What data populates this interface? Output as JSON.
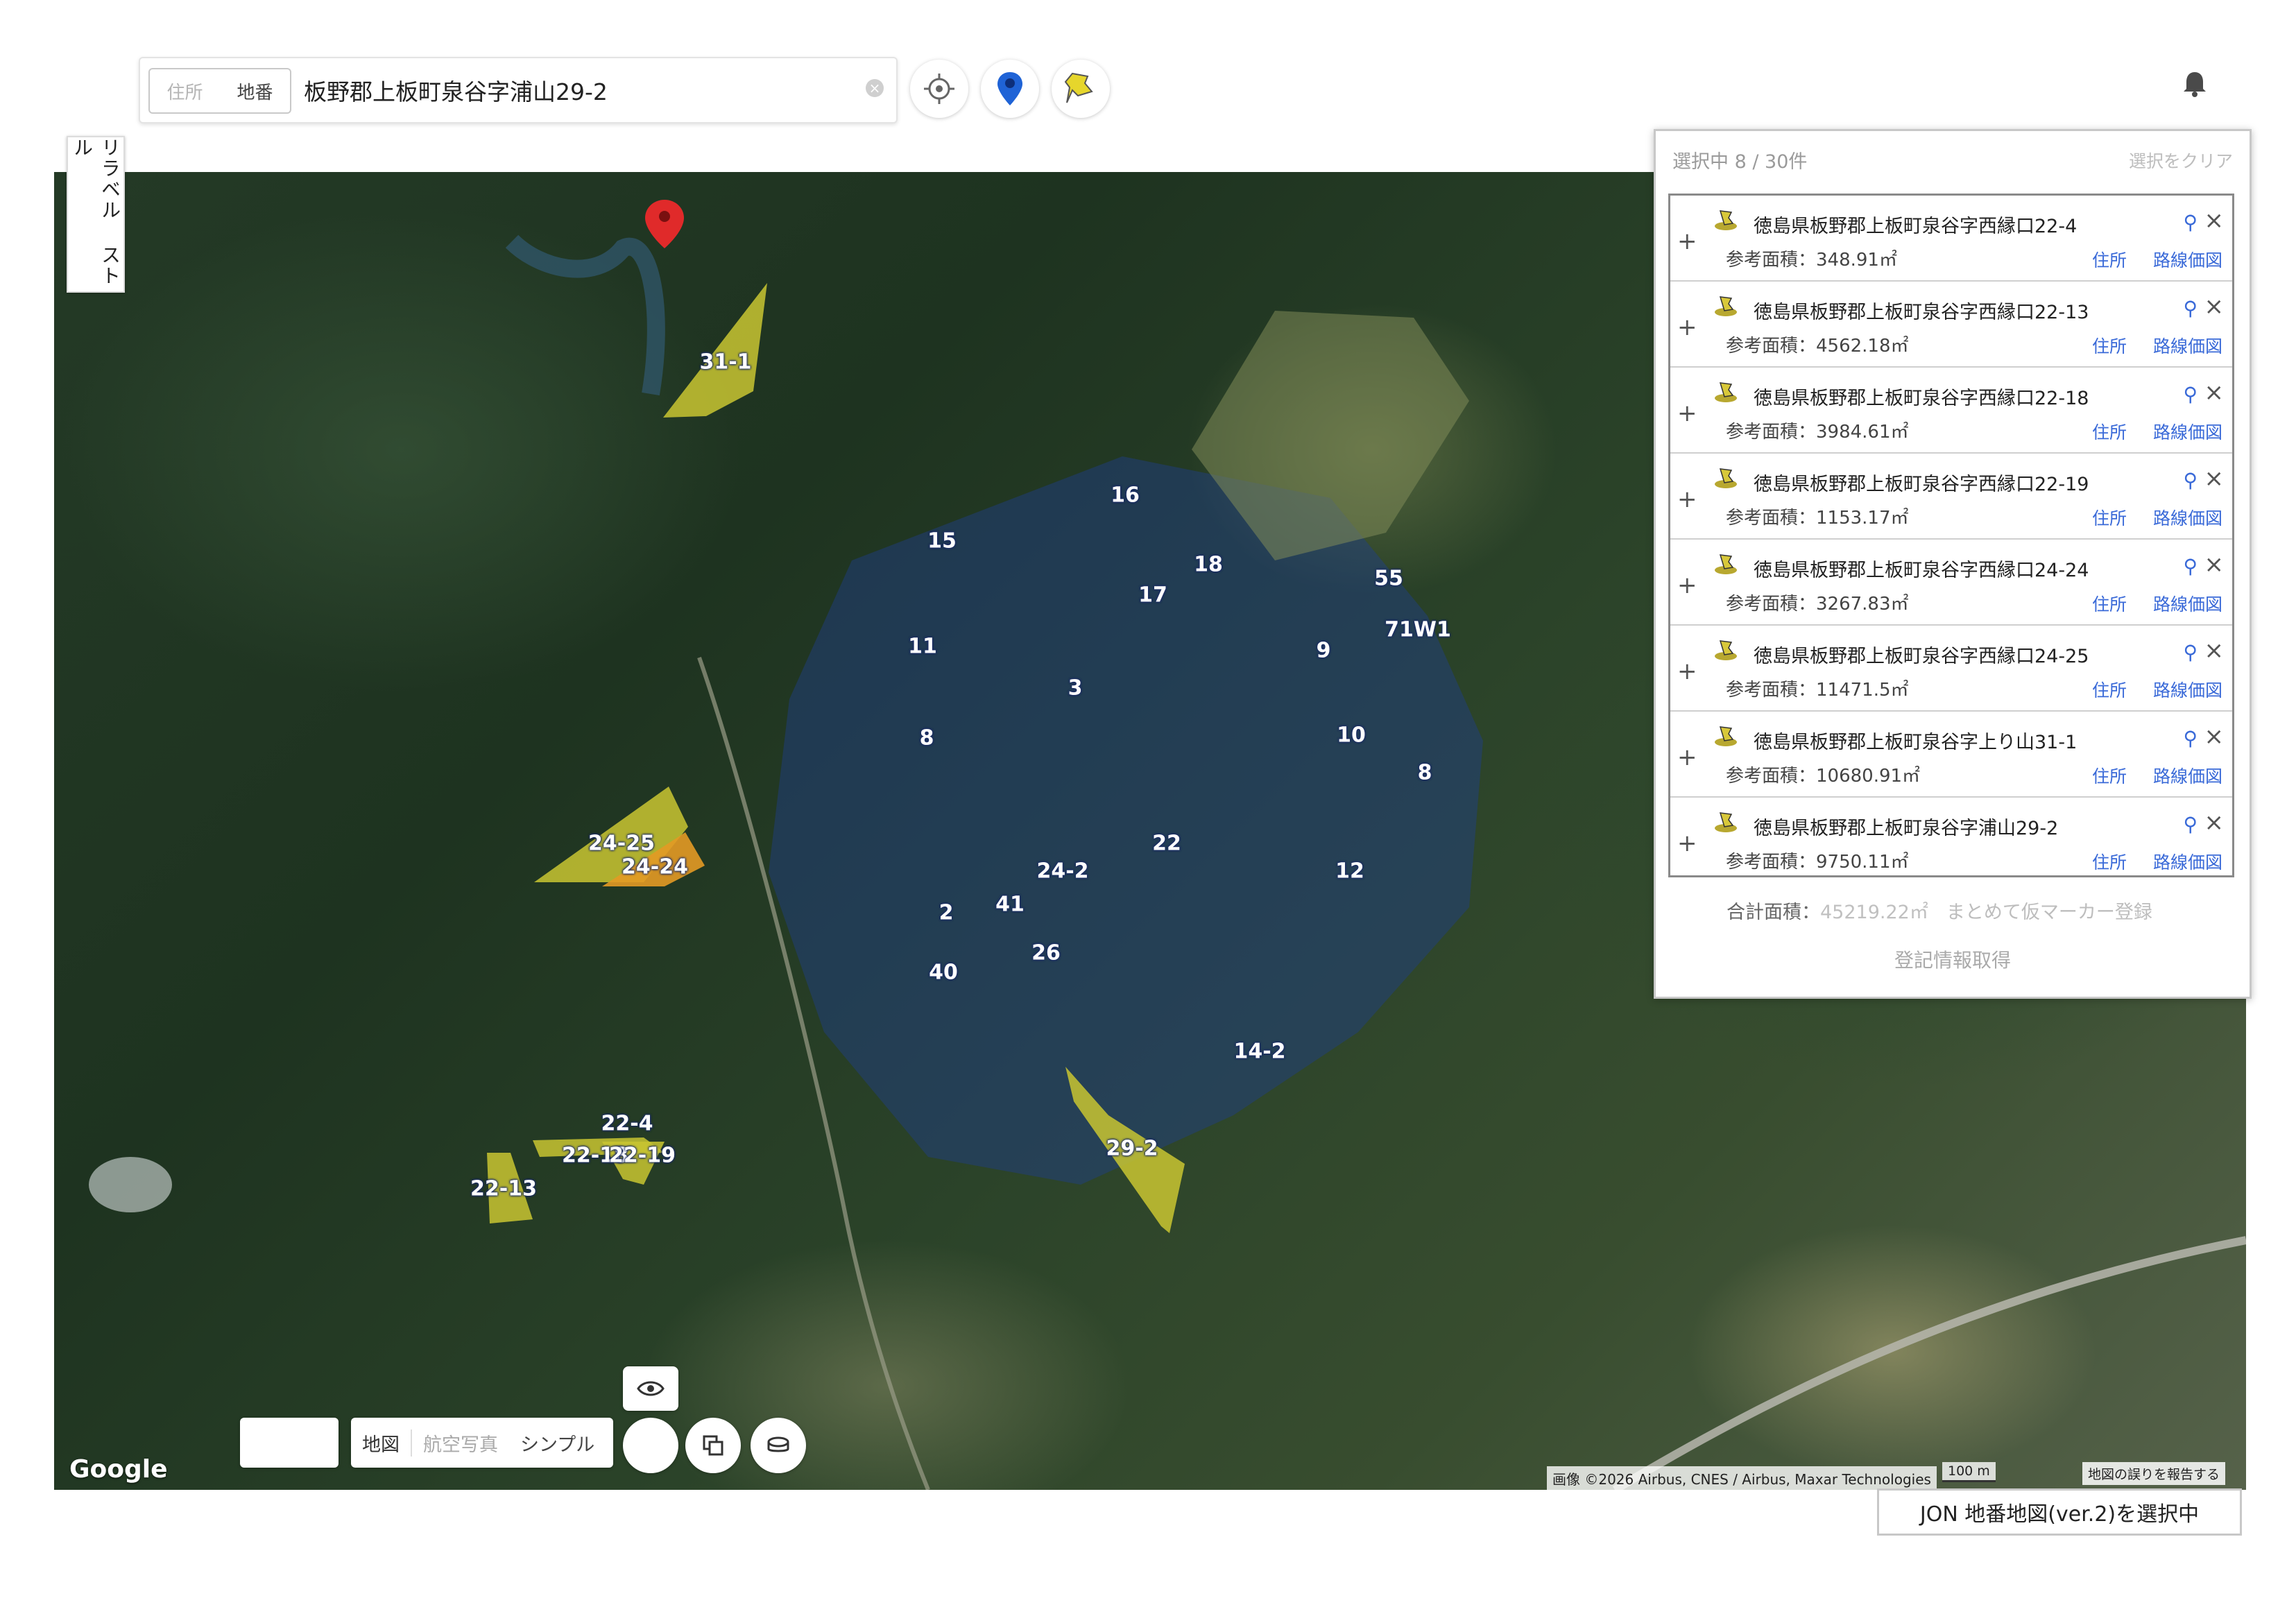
{
  "search": {
    "mode_options": [
      "住所",
      "地番"
    ],
    "value": "板野郡上板町泉谷字浦山29-2",
    "clear_glyph": "×"
  },
  "toolbar": {
    "icons": [
      "locate-icon",
      "map-pin-icon",
      "pushpin-icon"
    ]
  },
  "header": {
    "notification_icon": "bell-icon"
  },
  "map": {
    "relabel_button": "リラベル ストル",
    "google_logo": "Google",
    "attribution": "画像 ©2026 Airbus, CNES / Airbus, Maxar Technologies",
    "scale_label": "100 m",
    "report_link": "地図の誤りを報告する",
    "map_types": [
      "地図",
      "航空写真",
      "シンプル"
    ],
    "colors": {
      "selected_parcel": "#c9c531",
      "highlight_parcel": "#e39a25",
      "selected_region": "#1f3f8c",
      "marker": "#e02a2a"
    },
    "parcel_labels": [
      {
        "text": "31-1"
      },
      {
        "text": "15"
      },
      {
        "text": "16"
      },
      {
        "text": "18"
      },
      {
        "text": "17"
      },
      {
        "text": "55"
      },
      {
        "text": "71W1"
      },
      {
        "text": "11"
      },
      {
        "text": "3"
      },
      {
        "text": "9"
      },
      {
        "text": "8"
      },
      {
        "text": "10"
      },
      {
        "text": "8"
      },
      {
        "text": "22"
      },
      {
        "text": "24-25"
      },
      {
        "text": "24-24"
      },
      {
        "text": "24-2"
      },
      {
        "text": "12"
      },
      {
        "text": "2"
      },
      {
        "text": "41"
      },
      {
        "text": "40"
      },
      {
        "text": "26"
      },
      {
        "text": "14-2"
      },
      {
        "text": "22-4"
      },
      {
        "text": "22-18"
      },
      {
        "text": "22-19"
      },
      {
        "text": "22-13"
      },
      {
        "text": "29-2"
      }
    ]
  },
  "panel": {
    "count_label": "選択中 8 / 30件",
    "clear_label": "選択をクリア",
    "items": [
      {
        "address": "徳島県板野郡上板町泉谷字西縁口22-4",
        "area": "参考面積：348.91㎡",
        "link_address": "住所",
        "link_road": "路線価図"
      },
      {
        "address": "徳島県板野郡上板町泉谷字西縁口22-13",
        "area": "参考面積：4562.18㎡",
        "link_address": "住所",
        "link_road": "路線価図"
      },
      {
        "address": "徳島県板野郡上板町泉谷字西縁口22-18",
        "area": "参考面積：3984.61㎡",
        "link_address": "住所",
        "link_road": "路線価図"
      },
      {
        "address": "徳島県板野郡上板町泉谷字西縁口22-19",
        "area": "参考面積：1153.17㎡",
        "link_address": "住所",
        "link_road": "路線価図"
      },
      {
        "address": "徳島県板野郡上板町泉谷字西縁口24-24",
        "area": "参考面積：3267.83㎡",
        "link_address": "住所",
        "link_road": "路線価図"
      },
      {
        "address": "徳島県板野郡上板町泉谷字西縁口24-25",
        "area": "参考面積：11471.5㎡",
        "link_address": "住所",
        "link_road": "路線価図"
      },
      {
        "address": "徳島県板野郡上板町泉谷字上り山31-1",
        "area": "参考面積：10680.91㎡",
        "link_address": "住所",
        "link_road": "路線価図"
      },
      {
        "address": "徳島県板野郡上板町泉谷字浦山29-2",
        "area": "参考面積：9750.11㎡",
        "link_address": "住所",
        "link_road": "路線価図"
      }
    ],
    "total_label": "合計面積：",
    "total_value": "45219.22㎡",
    "bulk_register": "まとめて仮マーカー登録",
    "fetch_registry": "登記情報取得"
  },
  "status": {
    "selected_map": "JON 地番地図(ver.2)を選択中"
  }
}
